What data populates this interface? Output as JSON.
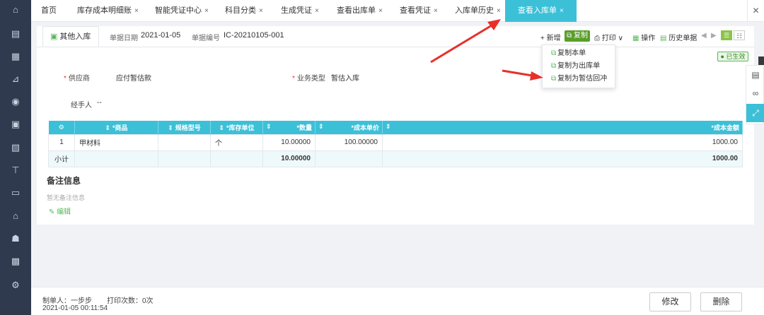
{
  "sidebar": {
    "icons": [
      "home-icon",
      "voucher-icon",
      "ledger-icon",
      "report-icon",
      "money-icon",
      "invoice-icon",
      "tax-icon",
      "cash-icon",
      "wallet-icon",
      "assets-icon",
      "payroll-icon",
      "inventory-icon",
      "settings-icon"
    ]
  },
  "tabs": [
    {
      "label": "首页",
      "closable": false
    },
    {
      "label": "库存成本明细账",
      "closable": true
    },
    {
      "label": "智能凭证中心",
      "closable": true
    },
    {
      "label": "科目分类",
      "closable": true
    },
    {
      "label": "生成凭证",
      "closable": true
    },
    {
      "label": "查看出库单",
      "closable": true
    },
    {
      "label": "查看凭证",
      "closable": true
    },
    {
      "label": "入库单历史",
      "closable": true
    },
    {
      "label": "查看入库单",
      "closable": true,
      "active": true
    }
  ],
  "tab_close": "×",
  "header": {
    "doc_type": "其他入库",
    "date_label": "单据日期",
    "date_value": "2021-01-05",
    "number_label": "单据编号",
    "number_value": "IC-20210105-001"
  },
  "toolbar": {
    "add": "+ 新增",
    "copy": "复制",
    "print": "打印",
    "operate": "操作",
    "history": "历史单据"
  },
  "copy_menu": [
    "复制本单",
    "复制为出库单",
    "复制为暂估回冲"
  ],
  "status": "已生效",
  "form": {
    "supplier_label": "供应商",
    "supplier_value": "应付暂估款",
    "biz_type_label": "业务类型",
    "biz_type_value": "暂估入库",
    "handler_label": "经手人",
    "handler_value": "--"
  },
  "table": {
    "columns": [
      "*商品",
      "规格型号",
      "*库存单位",
      "*数量",
      "*成本单价",
      "",
      "*成本金额"
    ],
    "rows": [
      {
        "index": "1",
        "product": "甲材料",
        "spec": "",
        "unit": "个",
        "qty": "10.00000",
        "unit_cost": "100.00000",
        "amount": "1000.00"
      }
    ],
    "subtotal": {
      "label": "小计",
      "qty": "10.00000",
      "amount": "1000.00"
    }
  },
  "memo": {
    "title": "备注信息",
    "empty": "暂无备注信息",
    "edit": "编辑"
  },
  "footer": {
    "creator": "制单人：一步步",
    "print_count": "打印次数：0次",
    "created_at": "2021-01-05 00:11:54",
    "modify": "修改",
    "delete": "删除"
  },
  "colors": {
    "accent": "#3cc0d8",
    "green": "#5bb75b",
    "copy_button": "#5a9e2a",
    "sidebar": "#2f3a4f",
    "arrow": "#e8302a"
  }
}
